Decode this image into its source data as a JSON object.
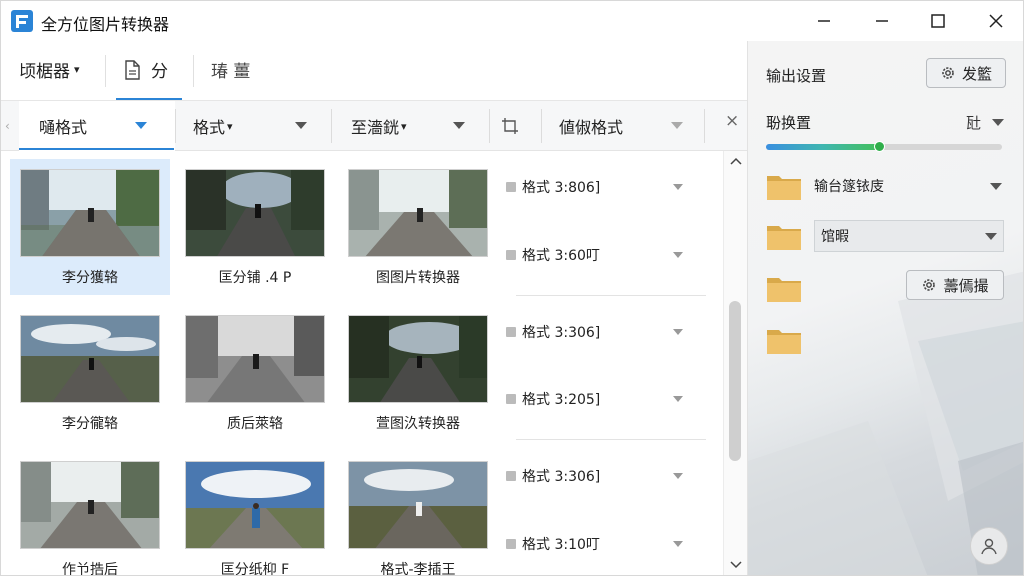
{
  "app": {
    "title": "全方位图片转换器"
  },
  "window": {
    "minimize_icon": "minimize-icon",
    "maximize_icon": "maximize-icon",
    "close_icon": "close-icon"
  },
  "toolbar": {
    "menu1": "顷椐器",
    "tab_active": "分",
    "tab2": "瑃 薑"
  },
  "filters": {
    "f1": "嗵格式",
    "f2": "格式",
    "f3": "至濇銧",
    "f4_icon": "crop-icon",
    "f5": "値俶格式",
    "close": "×"
  },
  "tiles": [
    {
      "label": "李分獲辂",
      "selected": true
    },
    {
      "label": "匡分铺 .4 P",
      "selected": false
    },
    {
      "label": "图图片转换器",
      "selected": false
    },
    {
      "label": "李分徿辂",
      "selected": false
    },
    {
      "label": "质后萊辂",
      "selected": false
    },
    {
      "label": "萱图汣转换器",
      "selected": false
    },
    {
      "label": "作兯捁后",
      "selected": false
    },
    {
      "label": "匡分纸枊 F",
      "selected": false
    },
    {
      "label": "格式-李插王",
      "selected": false
    }
  ],
  "formats": [
    "格式 3:806]",
    "格式 3:60叮",
    "格式 3:306]",
    "格式 3:205]",
    "格式 3:306]",
    "格式 3:10叮"
  ],
  "right": {
    "header": "输出设置",
    "settings_btn": "发籃",
    "quality_label": "聁换置",
    "quality_value": "瓧",
    "quality_fraction": 0.48,
    "folder1": "输台篴铱庋",
    "folder2": "馆暇",
    "browse_btn": "薵傿撮"
  },
  "colors": {
    "accent": "#2b84d6",
    "folder": "#e2b55a"
  }
}
